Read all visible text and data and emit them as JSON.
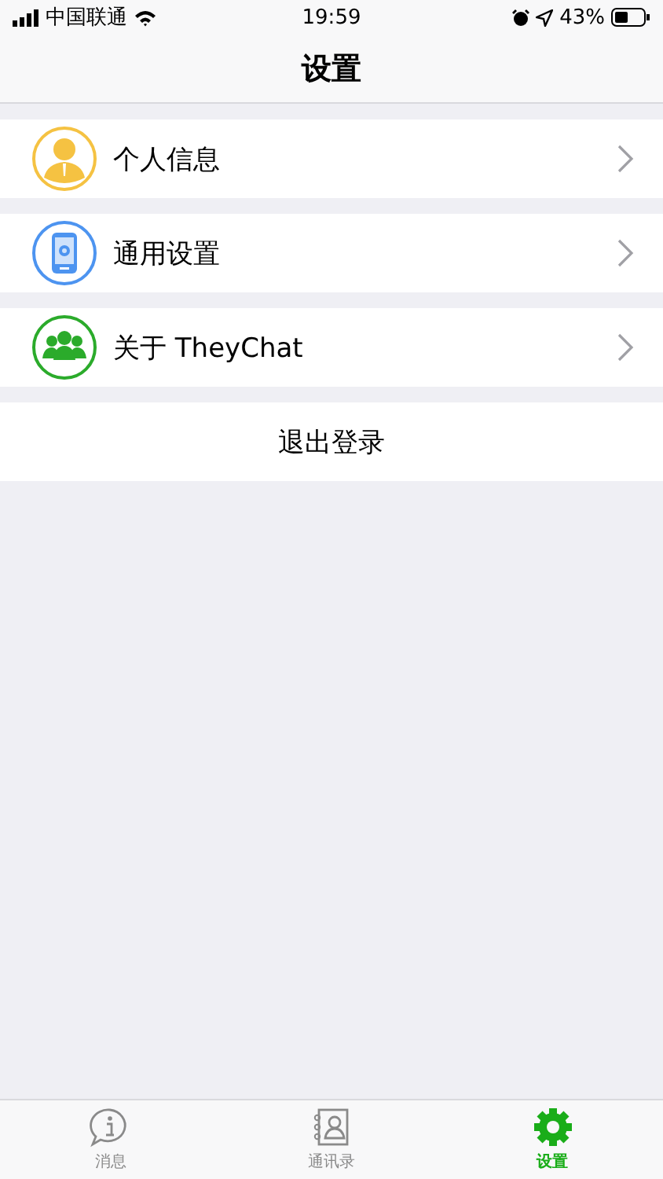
{
  "status_bar": {
    "carrier": "中国联通",
    "time": "19:59",
    "battery": "43%"
  },
  "nav_bar": {
    "title": "设置"
  },
  "menu": [
    {
      "kind": "person",
      "label": "个人信息"
    },
    {
      "kind": "phone",
      "label": "通用设置"
    },
    {
      "kind": "group",
      "label": "关于 TheyChat"
    }
  ],
  "logout_button": "退出登录",
  "tab_bar": [
    {
      "kind": "info",
      "label": "消息",
      "selected": false
    },
    {
      "kind": "contacts",
      "label": "通讯录",
      "selected": false
    },
    {
      "kind": "gear",
      "label": "设置",
      "selected": true
    }
  ]
}
